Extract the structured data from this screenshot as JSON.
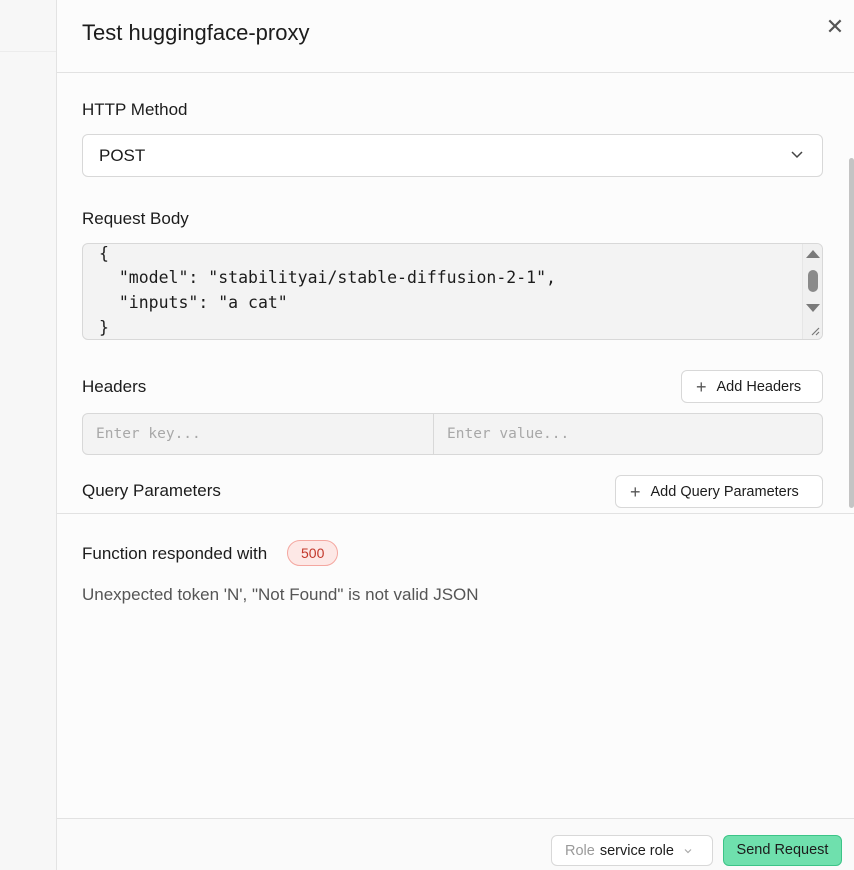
{
  "panel": {
    "title": "Test huggingface-proxy"
  },
  "form": {
    "http_method": {
      "label": "HTTP Method",
      "selected": "POST"
    },
    "request_body": {
      "label": "Request Body",
      "lines": [
        "{",
        "  \"model\": \"stabilityai/stable-diffusion-2-1\",",
        "  \"inputs\": \"a cat\"",
        "}"
      ]
    },
    "headers": {
      "label": "Headers",
      "add_label": "Add Headers",
      "key_placeholder": "Enter key...",
      "value_placeholder": "Enter value..."
    },
    "query_params": {
      "label": "Query Parameters",
      "add_label": "Add Query Parameters"
    }
  },
  "response": {
    "title": "Function responded with",
    "status_code": "500",
    "message": "Unexpected token 'N', \"Not Found\" is not valid JSON"
  },
  "footer": {
    "role_label": "Role",
    "role_value": "service role",
    "send_label": "Send Request"
  },
  "colors": {
    "send_button": "#6fe0ad",
    "error_badge_bg": "#fde8e6",
    "error_badge_text": "#c2382b"
  }
}
